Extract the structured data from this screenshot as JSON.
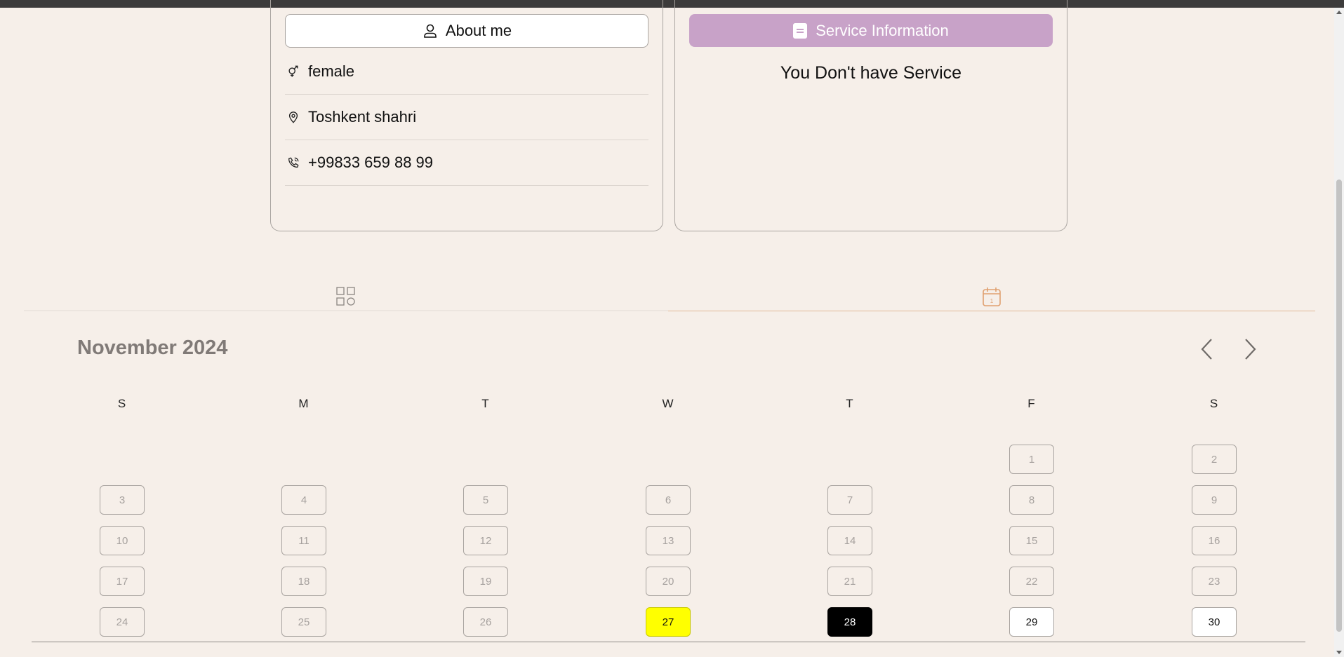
{
  "about": {
    "button_label": "About me",
    "gender": "female",
    "location": "Toshkent shahri",
    "phone": "+99833 659 88 99"
  },
  "service": {
    "button_label": "Service Information",
    "empty_message": "You Don't have Service"
  },
  "tabs": [
    {
      "icon": "grid-icon",
      "active": false
    },
    {
      "icon": "calendar-icon",
      "active": true
    }
  ],
  "calendar": {
    "month_label": "November 2024",
    "weekdays": [
      "S",
      "M",
      "T",
      "W",
      "T",
      "F",
      "S"
    ],
    "days": [
      {
        "n": "1",
        "state": "past"
      },
      {
        "n": "2",
        "state": "past"
      },
      {
        "n": "3",
        "state": "past"
      },
      {
        "n": "4",
        "state": "past"
      },
      {
        "n": "5",
        "state": "past"
      },
      {
        "n": "6",
        "state": "past"
      },
      {
        "n": "7",
        "state": "past"
      },
      {
        "n": "8",
        "state": "past"
      },
      {
        "n": "9",
        "state": "past"
      },
      {
        "n": "10",
        "state": "past"
      },
      {
        "n": "11",
        "state": "past"
      },
      {
        "n": "12",
        "state": "past"
      },
      {
        "n": "13",
        "state": "past"
      },
      {
        "n": "14",
        "state": "past"
      },
      {
        "n": "15",
        "state": "past"
      },
      {
        "n": "16",
        "state": "past"
      },
      {
        "n": "17",
        "state": "past"
      },
      {
        "n": "18",
        "state": "past"
      },
      {
        "n": "19",
        "state": "past"
      },
      {
        "n": "20",
        "state": "past"
      },
      {
        "n": "21",
        "state": "past"
      },
      {
        "n": "22",
        "state": "past"
      },
      {
        "n": "23",
        "state": "past"
      },
      {
        "n": "24",
        "state": "past"
      },
      {
        "n": "25",
        "state": "past"
      },
      {
        "n": "26",
        "state": "past"
      },
      {
        "n": "27",
        "state": "today"
      },
      {
        "n": "28",
        "state": "selected"
      },
      {
        "n": "29",
        "state": "available"
      },
      {
        "n": "30",
        "state": "available"
      }
    ]
  },
  "colors": {
    "background": "#f6efe9",
    "service_button": "#c8a2c8",
    "today": "#ffff00",
    "selected": "#000000",
    "active_tab": "#e0a070"
  }
}
